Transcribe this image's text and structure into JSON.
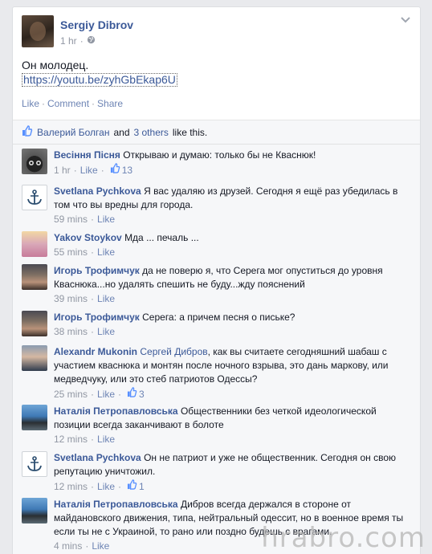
{
  "post": {
    "author": "Sergiy Dibrov",
    "time": "1 hr",
    "text": "Он молодец.",
    "link": "https://youtu.be/zyhGbEkap6U",
    "actions": {
      "like": "Like",
      "comment": "Comment",
      "share": "Share"
    }
  },
  "likes": {
    "first_name": "Валерий Болган",
    "and": "and",
    "others": "3 others",
    "suffix": "like this."
  },
  "comments": [
    {
      "author": "Весіння Пісня",
      "text": "Открываю и думаю: только бы не Кваснюк!",
      "time": "1 hr",
      "like": "Like",
      "likes": "13",
      "avatar": "cat-icon"
    },
    {
      "author": "Svetlana Pychkova",
      "text": "Я вас удаляю из друзей. Сегодня я ещё раз убедилась в том что вы вредны для города.",
      "time": "59 mins",
      "like": "Like",
      "avatar": "anchor-icon"
    },
    {
      "author": "Yakov Stoykov",
      "text": "Мда ... печаль ...",
      "time": "55 mins",
      "like": "Like",
      "avatar": "girl-photo"
    },
    {
      "author": "Игорь Трофимчук",
      "text": "да не поверю я, что Серега мог опуститься до уровня Кваснюка...но удалять спешить не буду...жду пояснений",
      "time": "39 mins",
      "like": "Like",
      "avatar": "man-photo"
    },
    {
      "author": "Игорь Трофимчук",
      "text": "Серега: а причем песня о письке?",
      "time": "38 mins",
      "like": "Like",
      "avatar": "man-photo"
    },
    {
      "author": "Alexandr Mukonin",
      "mention": "Сергей Дибров",
      "text": ", как вы считаете сегодняшний шабаш с участием кваснюка и монтян после ночного взрыва, это дань маркову, или медведчуку, или это стеб патриотов Одессы?",
      "time": "25 mins",
      "like": "Like",
      "likes": "3",
      "avatar": "man-photo"
    },
    {
      "author": "Наталія Петропавловська",
      "text": "Общественники без четкой идеологической позиции всегда заканчивают в болоте",
      "time": "12 mins",
      "like": "Like",
      "avatar": "woman-photo"
    },
    {
      "author": "Svetlana Pychkova",
      "text": "Он не патриот и уже не общественник. Сегодня он свою репутацию уничтожил.",
      "time": "12 mins",
      "like": "Like",
      "likes": "1",
      "avatar": "anchor-icon"
    },
    {
      "author": "Наталія Петропавловська",
      "text": "Дибров всегда держался в стороне от майдановского движения, типа, нейтральный одессит, но в военное время ты если ты не с Украиной, то рано или поздно будешь с врагами.",
      "time": "4 mins",
      "like": "Like",
      "avatar": "woman-photo"
    }
  ],
  "watermark": "hrabro.com",
  "colors": {
    "link": "#3b5998",
    "meta": "#9197a3",
    "background": "#e9eaed"
  }
}
